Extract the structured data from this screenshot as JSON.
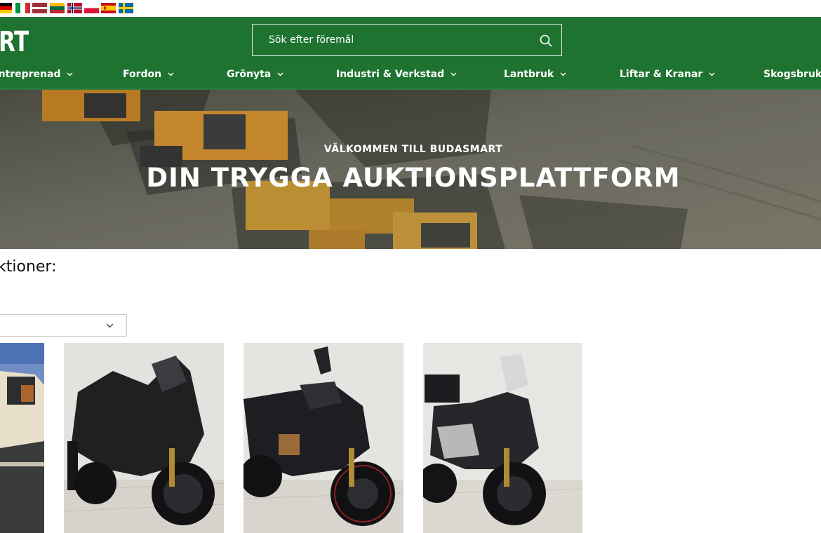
{
  "languages": [
    "German",
    "Italian",
    "Latvian",
    "Lithuanian",
    "Norwegian",
    "Polish",
    "Spanish",
    "Swedish"
  ],
  "header": {
    "logo_text": "RT",
    "search_placeholder": "Sök efter föremål",
    "brand_color": "#1e7331"
  },
  "nav": {
    "items": [
      {
        "label": "Entreprenad"
      },
      {
        "label": "Fordon"
      },
      {
        "label": "Grönyta"
      },
      {
        "label": "Industri & Verkstad"
      },
      {
        "label": "Lantbruk"
      },
      {
        "label": "Liftar & Kranar"
      },
      {
        "label": "Skogsbruk"
      }
    ]
  },
  "hero": {
    "subtitle": "VÄLKOMMEN TILL BUDASMART",
    "title": "DIN TRYGGA AUKTIONSPLATTFORM"
  },
  "auctions": {
    "heading": "ktioner:",
    "filter_value": "",
    "items": [
      {
        "image": "car-photo"
      },
      {
        "image": "maxi-scooter-photo"
      },
      {
        "image": "naked-motorcycle-photo"
      },
      {
        "image": "adventure-scooter-photo"
      }
    ]
  }
}
